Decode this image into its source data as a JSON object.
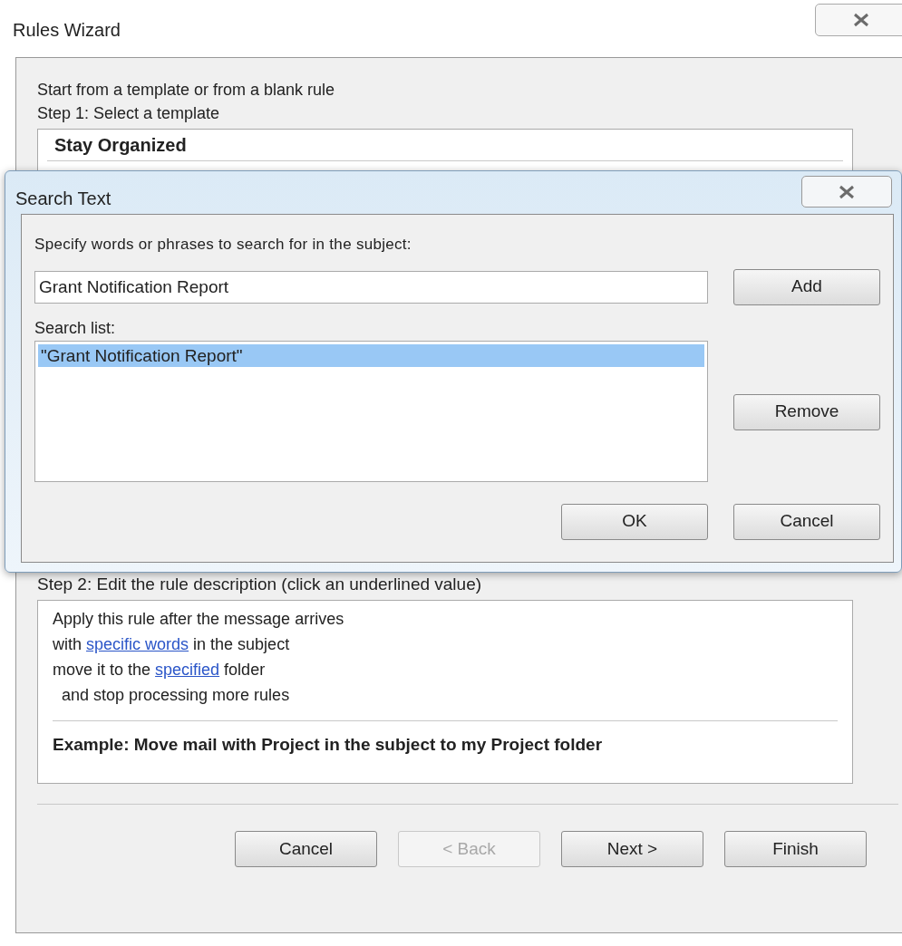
{
  "window": {
    "title": "Rules Wizard"
  },
  "intro": "Start from a template or from a blank rule",
  "step1": {
    "label": "Step 1: Select a template",
    "group": "Stay Organized"
  },
  "dialog": {
    "title": "Search Text",
    "prompt": "Specify words or phrases to search for in the subject:",
    "input": {
      "value": "Grant Notification Report"
    },
    "add_button": "Add",
    "list_label": "Search list:",
    "list": [
      {
        "text": "\"Grant Notification Report\"",
        "selected": true
      }
    ],
    "remove_button": "Remove",
    "buttons": [
      {
        "label": "OK",
        "disabled": false
      },
      {
        "label": "Cancel",
        "disabled": false
      }
    ]
  },
  "step2": {
    "label": "Step 2: Edit the rule description (click an underlined value)",
    "lines": [
      [
        {
          "text": "Apply this rule after the message arrives",
          "link": false
        }
      ],
      [
        {
          "text": "with ",
          "link": false
        },
        {
          "text": "specific words",
          "link": true
        },
        {
          "text": " in the subject",
          "link": false
        }
      ],
      [
        {
          "text": "move it to the ",
          "link": false
        },
        {
          "text": "specified",
          "link": true
        },
        {
          "text": " folder",
          "link": false
        }
      ],
      [
        {
          "text": "  and stop processing more rules",
          "link": false
        }
      ]
    ],
    "example": "Example: Move mail with Project in the subject to my Project folder"
  },
  "buttons": [
    {
      "label": "Cancel",
      "disabled": false
    },
    {
      "label": "< Back",
      "disabled": true
    },
    {
      "label": "Next >",
      "disabled": false
    },
    {
      "label": "Finish",
      "disabled": false
    }
  ]
}
